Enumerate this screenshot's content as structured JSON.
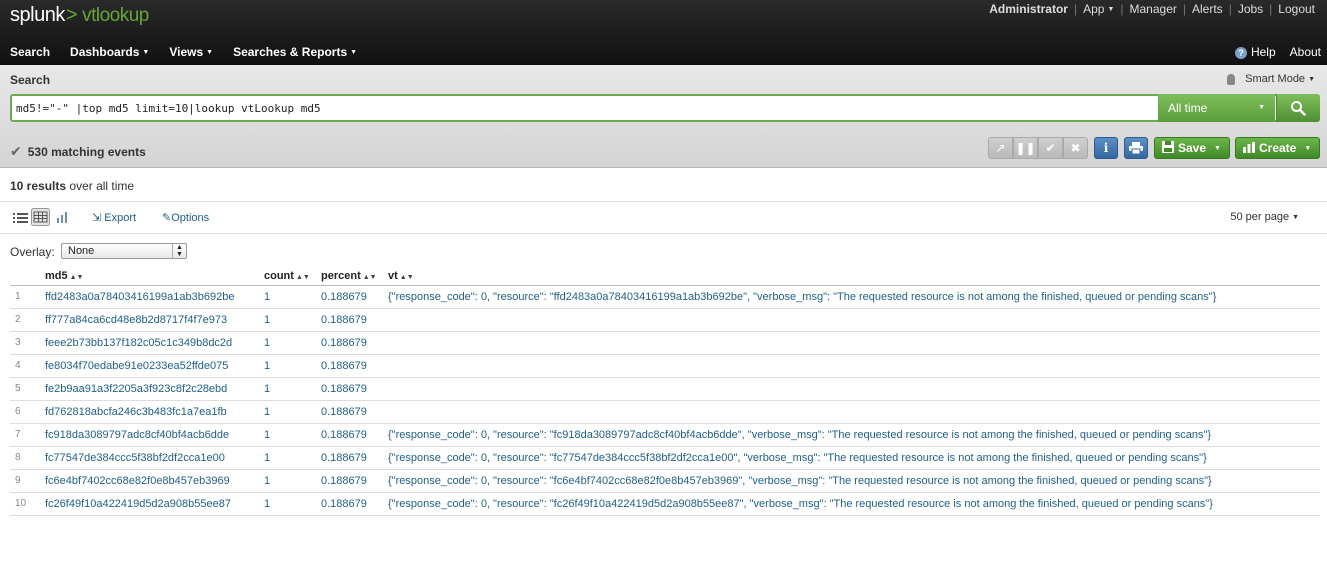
{
  "header": {
    "brand": "splunk",
    "app_name": "vtlookup",
    "account_menu": [
      {
        "label": "Administrator",
        "dropdown": false
      },
      {
        "label": "App",
        "dropdown": true
      },
      {
        "label": "Manager",
        "dropdown": false
      },
      {
        "label": "Alerts",
        "dropdown": false
      },
      {
        "label": "Jobs",
        "dropdown": false
      },
      {
        "label": "Logout",
        "dropdown": false
      }
    ],
    "nav": [
      {
        "label": "Search"
      },
      {
        "label": "Dashboards"
      },
      {
        "label": "Views"
      },
      {
        "label": "Searches & Reports"
      }
    ],
    "help_label": "Help",
    "about_label": "About"
  },
  "search": {
    "title": "Search",
    "mode_label": "Smart Mode",
    "query": "md5!=\"-\" |top md5 limit=10|lookup vtLookup md5",
    "time_range": "All time",
    "matching_events": "530 matching events",
    "save_label": "Save",
    "create_label": "Create"
  },
  "results": {
    "count_label": "10 results",
    "range_label": "over all time",
    "export_label": "Export",
    "options_label": "Options",
    "per_page_label": "50 per page",
    "overlay_label": "Overlay:",
    "overlay_value": "None",
    "columns": [
      "md5",
      "count",
      "percent",
      "vt"
    ],
    "rows": [
      {
        "n": "1",
        "md5": "ffd2483a0a78403416199a1ab3b692be",
        "count": "1",
        "percent": "0.188679",
        "vt": "{\"response_code\": 0, \"resource\": \"ffd2483a0a78403416199a1ab3b692be\", \"verbose_msg\": \"The requested resource is not among the finished, queued or pending scans\"}"
      },
      {
        "n": "2",
        "md5": "ff777a84ca6cd48e8b2d8717f4f7e973",
        "count": "1",
        "percent": "0.188679",
        "vt": ""
      },
      {
        "n": "3",
        "md5": "feee2b73bb137f182c05c1c349b8dc2d",
        "count": "1",
        "percent": "0.188679",
        "vt": ""
      },
      {
        "n": "4",
        "md5": "fe8034f70edabe91e0233ea52ffde075",
        "count": "1",
        "percent": "0.188679",
        "vt": ""
      },
      {
        "n": "5",
        "md5": "fe2b9aa91a3f2205a3f923c8f2c28ebd",
        "count": "1",
        "percent": "0.188679",
        "vt": ""
      },
      {
        "n": "6",
        "md5": "fd762818abcfa246c3b483fc1a7ea1fb",
        "count": "1",
        "percent": "0.188679",
        "vt": ""
      },
      {
        "n": "7",
        "md5": "fc918da3089797adc8cf40bf4acb6dde",
        "count": "1",
        "percent": "0.188679",
        "vt": "{\"response_code\": 0, \"resource\": \"fc918da3089797adc8cf40bf4acb6dde\", \"verbose_msg\": \"The requested resource is not among the finished, queued or pending scans\"}"
      },
      {
        "n": "8",
        "md5": "fc77547de384ccc5f38bf2df2cca1e00",
        "count": "1",
        "percent": "0.188679",
        "vt": "{\"response_code\": 0, \"resource\": \"fc77547de384ccc5f38bf2df2cca1e00\", \"verbose_msg\": \"The requested resource is not among the finished, queued or pending scans\"}"
      },
      {
        "n": "9",
        "md5": "fc6e4bf7402cc68e82f0e8b457eb3969",
        "count": "1",
        "percent": "0.188679",
        "vt": "{\"response_code\": 0, \"resource\": \"fc6e4bf7402cc68e82f0e8b457eb3969\", \"verbose_msg\": \"The requested resource is not among the finished, queued or pending scans\"}"
      },
      {
        "n": "10",
        "md5": "fc26f49f10a422419d5d2a908b55ee87",
        "count": "1",
        "percent": "0.188679",
        "vt": "{\"response_code\": 0, \"resource\": \"fc26f49f10a422419d5d2a908b55ee87\", \"verbose_msg\": \"The requested resource is not among the finished, queued or pending scans\"}"
      }
    ]
  },
  "icons": {
    "list": "list-view-icon",
    "table": "table-view-icon",
    "chart": "chart-view-icon",
    "export": "export-icon",
    "options": "edit-icon",
    "search": "magnifier-icon"
  },
  "colors": {
    "accent_green": "#65a637",
    "link_blue": "#1f5f8b",
    "header_bg": "#1a1a1a"
  }
}
